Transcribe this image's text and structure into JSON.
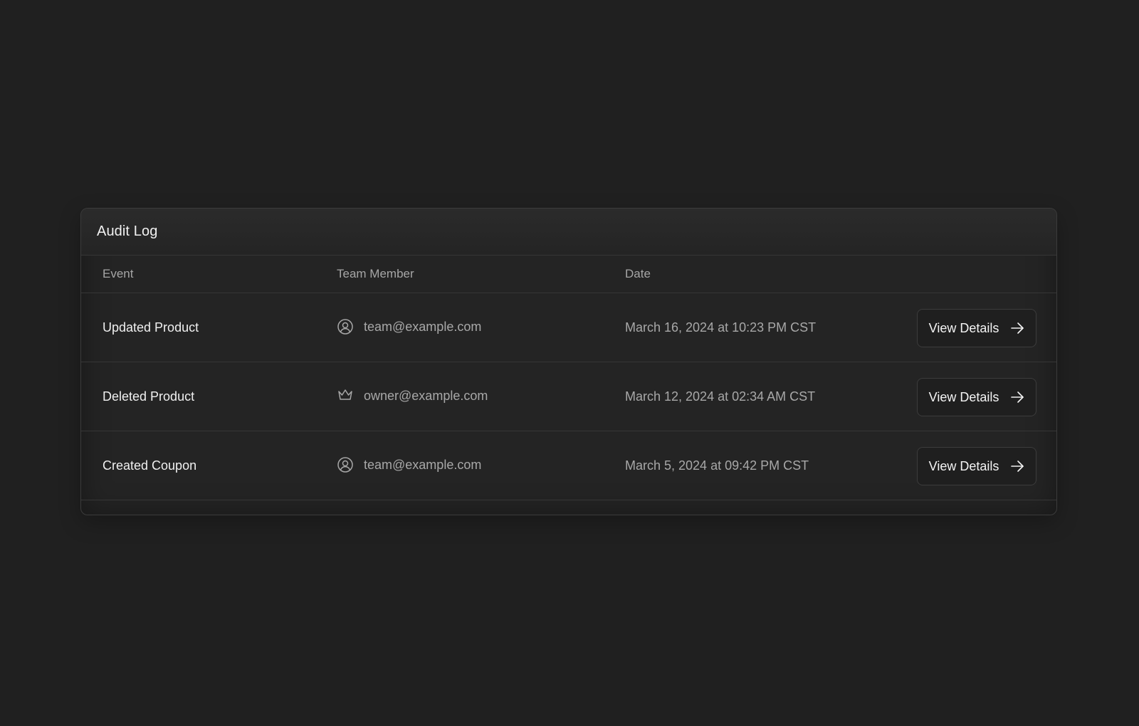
{
  "card": {
    "title": "Audit Log"
  },
  "table": {
    "headers": [
      "Event",
      "Team Member",
      "Date"
    ],
    "rows": [
      {
        "event": "Updated Product",
        "member_icon": "user-circle-icon",
        "member": "team@example.com",
        "date": "March 16, 2024 at 10:23 PM CST",
        "action": "View Details"
      },
      {
        "event": "Deleted Product",
        "member_icon": "crown-icon",
        "member": "owner@example.com",
        "date": "March 12, 2024 at 02:34 AM CST",
        "action": "View Details"
      },
      {
        "event": "Created Coupon",
        "member_icon": "user-circle-icon",
        "member": "team@example.com",
        "date": "March 5, 2024 at 09:42 PM CST",
        "action": "View Details"
      }
    ]
  },
  "colors": {
    "background": "#202020",
    "card": "#242424",
    "text_primary": "#f0f0f0",
    "text_secondary": "#a8a8a8"
  }
}
